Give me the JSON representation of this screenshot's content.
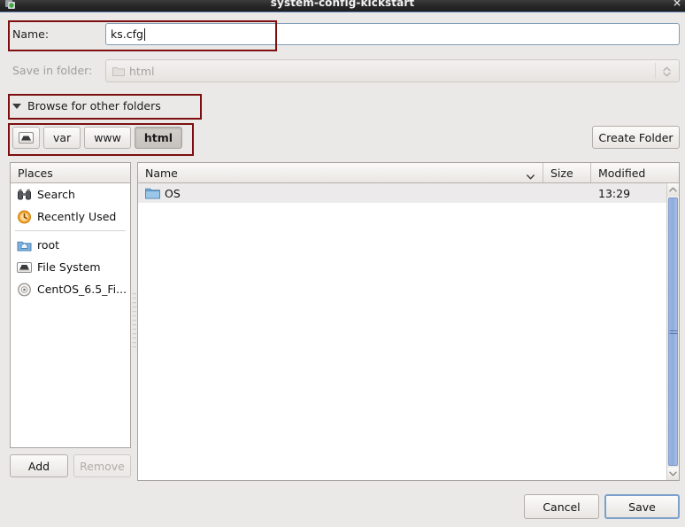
{
  "window": {
    "title": "system-config-kickstart",
    "close_label": "×",
    "app_icon": "window-icon"
  },
  "name_row": {
    "label": "Name:",
    "value": "ks.cfg",
    "placeholder": ""
  },
  "save_in_folder": {
    "label": "Save in folder:",
    "value": "html",
    "enabled": false
  },
  "expander": {
    "label": "Browse for other folders",
    "expanded": true
  },
  "breadcrumbs": {
    "items": [
      {
        "label": "",
        "icon": "drive-icon",
        "active": false
      },
      {
        "label": "var",
        "icon": "",
        "active": false
      },
      {
        "label": "www",
        "icon": "",
        "active": false
      },
      {
        "label": "html",
        "icon": "",
        "active": true
      }
    ],
    "create_folder_label": "Create Folder"
  },
  "places": {
    "header": "Places",
    "items": [
      {
        "label": "Search",
        "icon": "binoculars-icon"
      },
      {
        "label": "Recently Used",
        "icon": "recent-clock-icon"
      },
      {
        "label": "root",
        "icon": "home-folder-icon"
      },
      {
        "label": "File System",
        "icon": "drive-icon"
      },
      {
        "label": "CentOS_6.5_Fi...",
        "icon": "disc-icon"
      }
    ],
    "add_label": "Add",
    "remove_label": "Remove",
    "remove_enabled": false
  },
  "file_list": {
    "columns": [
      {
        "key": "name",
        "label": "Name",
        "sorted": true
      },
      {
        "key": "size",
        "label": "Size",
        "sorted": false
      },
      {
        "key": "modified",
        "label": "Modified",
        "sorted": false
      }
    ],
    "rows": [
      {
        "name": "OS",
        "size": "",
        "modified": "13:29",
        "icon": "folder-icon",
        "selected": true
      }
    ]
  },
  "actions": {
    "cancel_label": "Cancel",
    "save_label": "Save",
    "default_button": "save"
  },
  "colors": {
    "window_bg": "#ebe9e7",
    "annotation_red": "#7d0f10",
    "focus_blue": "#7f9db9",
    "scrollbar_blue": "#8fabdb",
    "titlebar_dark": "#262626"
  }
}
